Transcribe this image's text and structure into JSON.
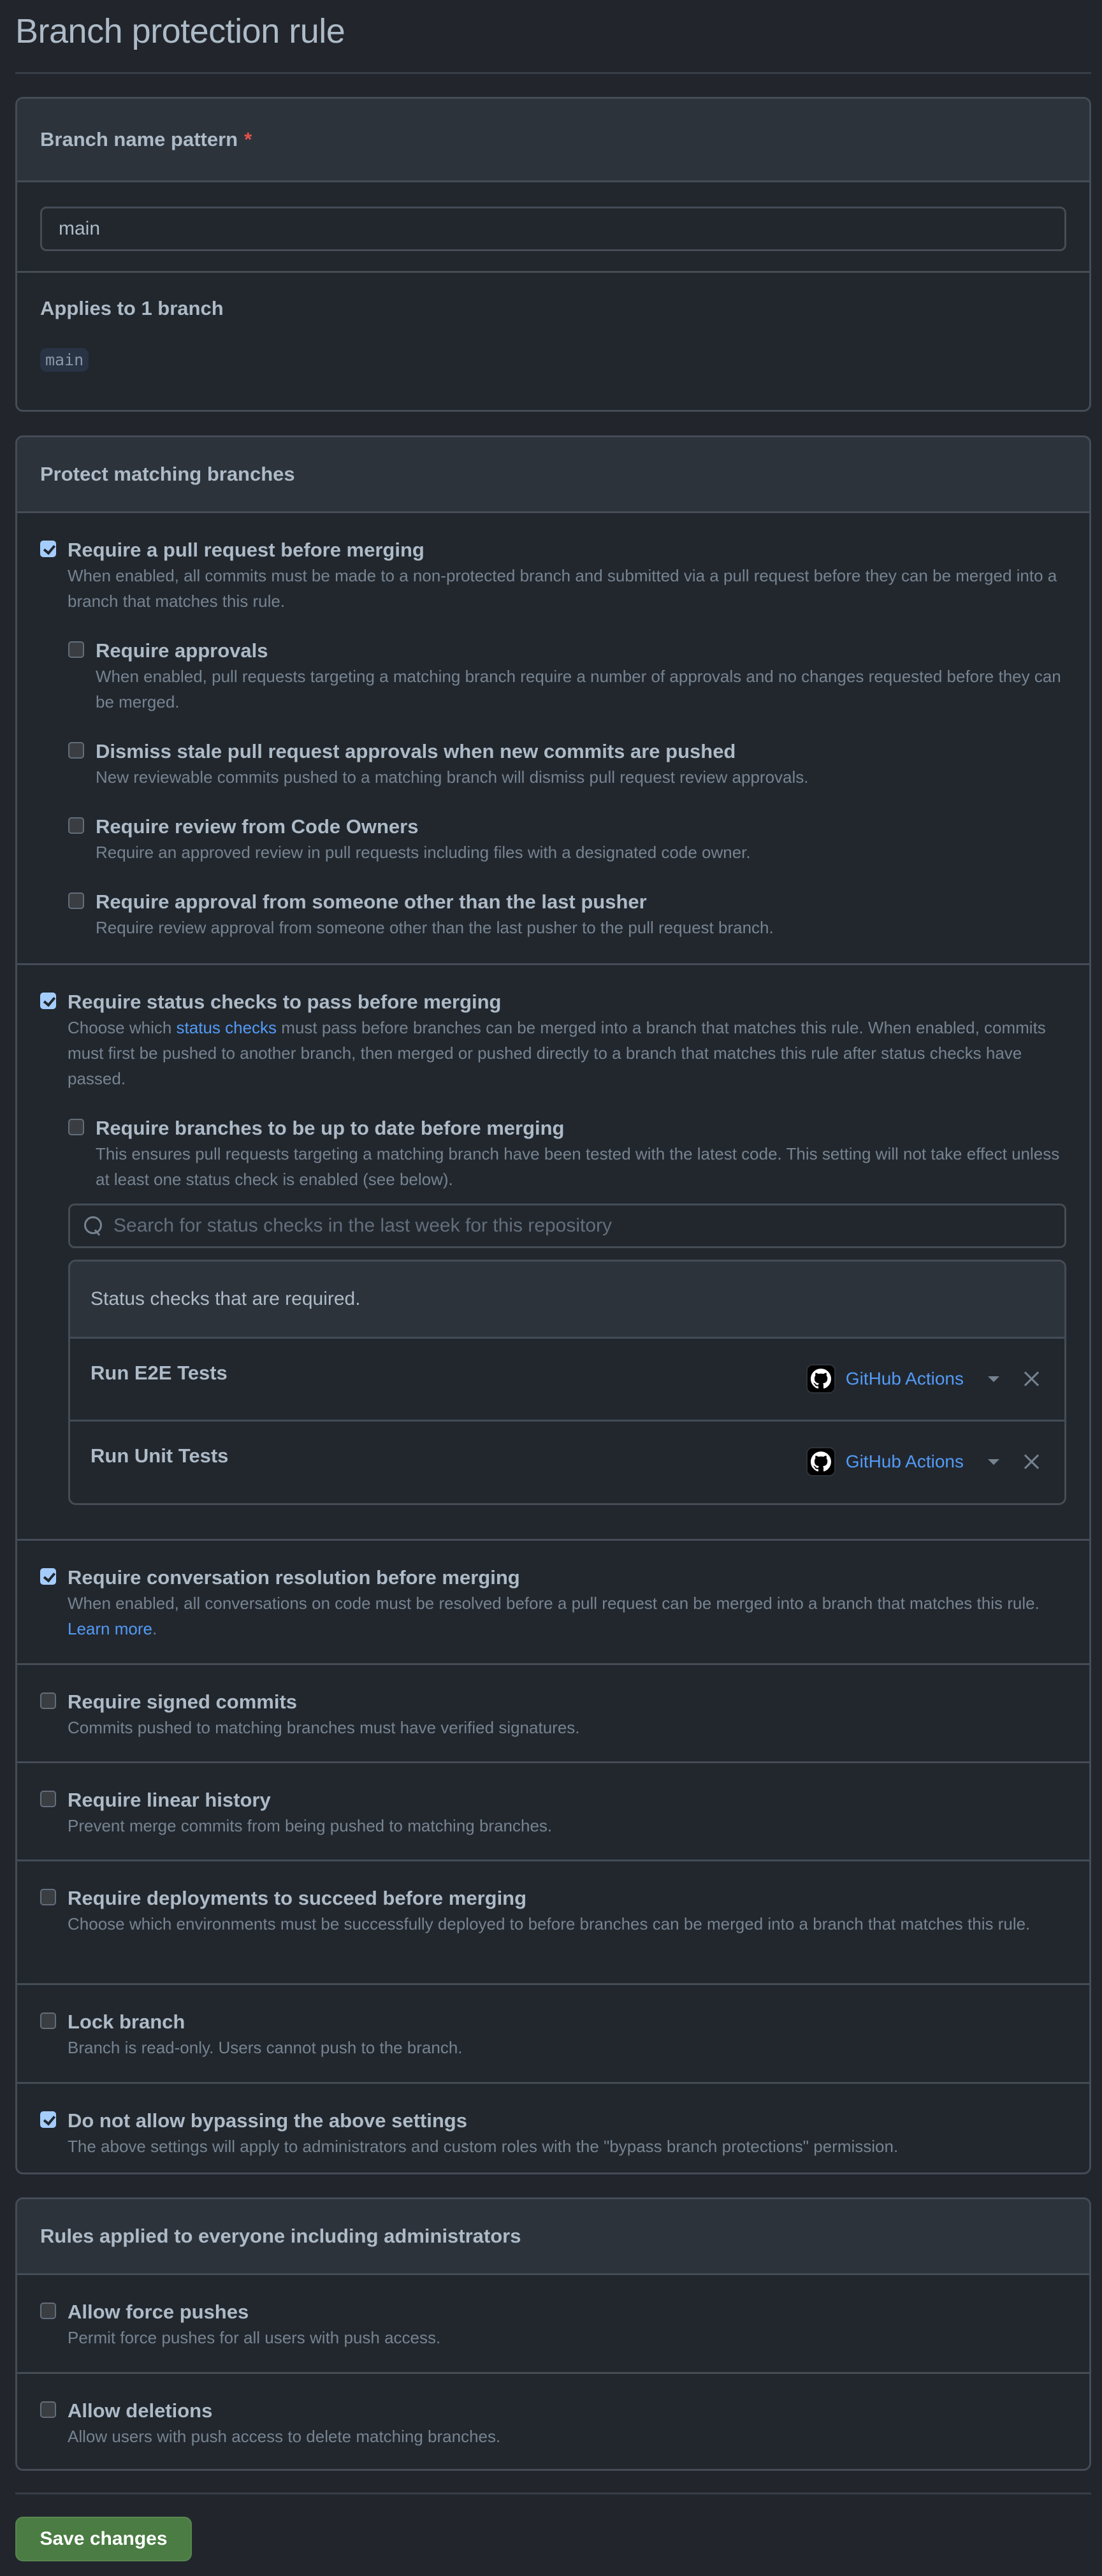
{
  "page": {
    "title": "Branch protection rule"
  },
  "pattern_box": {
    "header": "Branch name pattern",
    "required_mark": "*",
    "input_value": "main",
    "applies_title": "Applies to 1 branch",
    "branches": [
      "main"
    ]
  },
  "protect_box": {
    "header": "Protect matching branches",
    "pull_request": {
      "checked": true,
      "title": "Require a pull request before merging",
      "desc": "When enabled, all commits must be made to a non-protected branch and submitted via a pull request before they can be merged into a branch that matches this rule.",
      "sub": [
        {
          "checked": false,
          "title": "Require approvals",
          "desc": "When enabled, pull requests targeting a matching branch require a number of approvals and no changes requested before they can be merged."
        },
        {
          "checked": false,
          "title": "Dismiss stale pull request approvals when new commits are pushed",
          "desc": "New reviewable commits pushed to a matching branch will dismiss pull request review approvals."
        },
        {
          "checked": false,
          "title": "Require review from Code Owners",
          "desc": "Require an approved review in pull requests including files with a designated code owner."
        },
        {
          "checked": false,
          "title": "Require approval from someone other than the last pusher",
          "desc": "Require review approval from someone other than the last pusher to the pull request branch."
        }
      ]
    },
    "status_checks": {
      "checked": true,
      "title": "Require status checks to pass before merging",
      "desc_prefix": "Choose which ",
      "desc_link": "status checks",
      "desc_suffix": " must pass before branches can be merged into a branch that matches this rule. When enabled, commits must first be pushed to another branch, then merged or pushed directly to a branch that matches this rule after status checks have passed.",
      "up_to_date": {
        "checked": false,
        "title": "Require branches to be up to date before merging",
        "desc": "This ensures pull requests targeting a matching branch have been tested with the latest code. This setting will not take effect unless at least one status check is enabled (see below)."
      },
      "search_placeholder": "Search for status checks in the last week for this repository",
      "required_header": "Status checks that are required.",
      "checks": [
        {
          "name": "Run E2E Tests",
          "app": "GitHub Actions"
        },
        {
          "name": "Run Unit Tests",
          "app": "GitHub Actions"
        }
      ]
    },
    "conversation": {
      "checked": true,
      "title": "Require conversation resolution before merging",
      "desc": "When enabled, all conversations on code must be resolved before a pull request can be merged into a branch that matches this rule. ",
      "link": "Learn more",
      "link_suffix": "."
    },
    "signed_commits": {
      "checked": false,
      "title": "Require signed commits",
      "desc": "Commits pushed to matching branches must have verified signatures."
    },
    "linear_history": {
      "checked": false,
      "title": "Require linear history",
      "desc": "Prevent merge commits from being pushed to matching branches."
    },
    "deployments": {
      "checked": false,
      "title": "Require deployments to succeed before merging",
      "desc": "Choose which environments must be successfully deployed to before branches can be merged into a branch that matches this rule."
    },
    "lock_branch": {
      "checked": false,
      "title": "Lock branch",
      "desc": "Branch is read-only. Users cannot push to the branch."
    },
    "no_bypass": {
      "checked": true,
      "title": "Do not allow bypassing the above settings",
      "desc": "The above settings will apply to administrators and custom roles with the \"bypass branch protections\" permission."
    }
  },
  "everyone_box": {
    "header": "Rules applied to everyone including administrators",
    "force_pushes": {
      "checked": false,
      "title": "Allow force pushes",
      "desc": "Permit force pushes for all users with push access."
    },
    "deletions": {
      "checked": false,
      "title": "Allow deletions",
      "desc": "Allow users with push access to delete matching branches."
    }
  },
  "footer": {
    "save_label": "Save changes"
  },
  "colors": {
    "accent_link": "#539bf5",
    "checkbox_checked": "#a5cdfc",
    "save_button": "#4a7c43",
    "required_star": "#e5534b"
  }
}
